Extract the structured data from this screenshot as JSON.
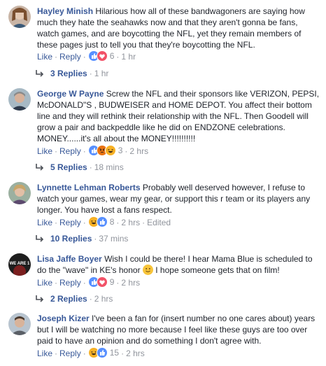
{
  "actions": {
    "like": "Like",
    "reply": "Reply",
    "sep": "·"
  },
  "colors": {
    "link": "#385898",
    "meta": "#90949c",
    "text": "#1d2129",
    "like_blue": "#5890ff"
  },
  "comments": [
    {
      "author": "Hayley Minish",
      "text": "Hilarious how all of these bandwagoners are saying how much they hate the seahawks now and that they aren't gonna be fans, watch games, and are boycotting the NFL, yet they remain members of these pages just to tell you that they're boycotting the NFL.",
      "reactions": [
        "like-icon",
        "love-icon"
      ],
      "reaction_count": "6",
      "time": "1 hr",
      "edited": "",
      "replies": {
        "label": "3 Replies",
        "time": "1 hr"
      }
    },
    {
      "author": "George W Payne",
      "text": "Screw the NFL and their sponsors like VERIZON, PEPSI, McDONALD\"S , BUDWEISER and HOME DEPOT. You affect their bottom line and they will rethink their relationship with the NFL. Then Goodell will grow a pair and backpeddle like he did on ENDZONE celebrations. MONEY......it's all about the MONEY!!!!!!!!!!",
      "reactions": [
        "like-icon",
        "angry-icon",
        "haha-icon"
      ],
      "reaction_count": "3",
      "time": "2 hrs",
      "edited": "",
      "replies": {
        "label": "5 Replies",
        "time": "18 mins"
      }
    },
    {
      "author": "Lynnette Lehman Roberts",
      "text": "Probably well deserved however, I refuse to watch your games, wear my gear, or support this r team or its players any longer. You have lost a fans respect.",
      "reactions": [
        "haha-icon",
        "like-icon"
      ],
      "reaction_count": "8",
      "time": "2 hrs",
      "edited": "Edited",
      "replies": {
        "label": "10 Replies",
        "time": "37 mins"
      }
    },
    {
      "author": "Lisa Jaffe Boyer",
      "text_before": "Wish I could be there! I hear Mama Blue is scheduled to do the \"wave\" in KE's honor",
      "text_after": "I hope someone gets that on film!",
      "inline_emoji": "smile-emoji-icon",
      "avatar_text": "WE ARE 1",
      "reactions": [
        "like-icon",
        "love-icon"
      ],
      "reaction_count": "9",
      "time": "2 hrs",
      "edited": "",
      "replies": {
        "label": "2 Replies",
        "time": "2 hrs"
      }
    },
    {
      "author": "Joseph Kizer",
      "text": "I've been a fan for (insert number no one cares about) years but I will be watching no more because I feel like these guys are too over paid to have an opinion and do something I don't agree with.",
      "reactions": [
        "haha-icon",
        "like-icon"
      ],
      "reaction_count": "15",
      "time": "2 hrs",
      "edited": "",
      "replies": null
    }
  ]
}
